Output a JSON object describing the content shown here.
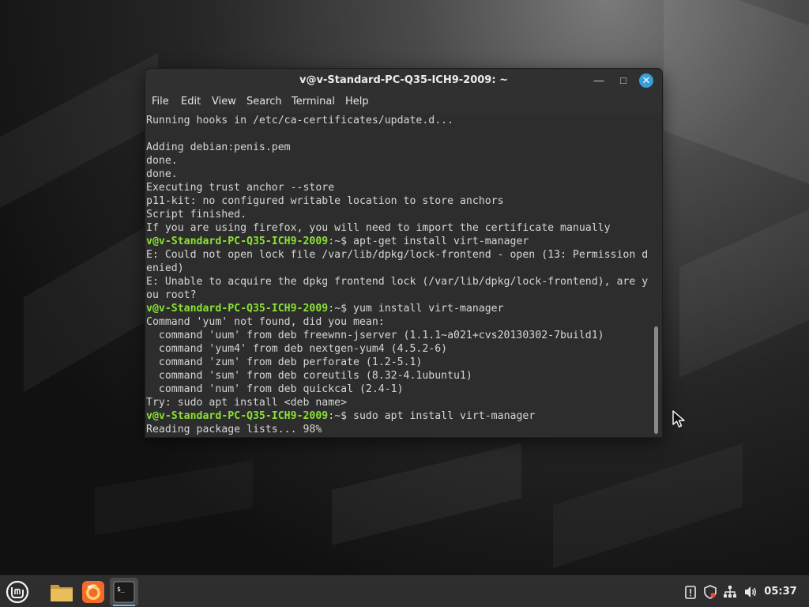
{
  "window": {
    "title": "v@v-Standard-PC-Q35-ICH9-2009: ~",
    "minimize_glyph": "—",
    "maximize_glyph": "□",
    "close_glyph": "✕"
  },
  "menu": [
    "File",
    "Edit",
    "View",
    "Search",
    "Terminal",
    "Help"
  ],
  "terminal": {
    "prompt_user": "v@v-Standard-PC-Q35-ICH9-2009",
    "prompt_suffix": ":~$ ",
    "lines": [
      {
        "type": "out",
        "text": "Running hooks in /etc/ca-certificates/update.d..."
      },
      {
        "type": "out",
        "text": ""
      },
      {
        "type": "out",
        "text": "Adding debian:penis.pem"
      },
      {
        "type": "out",
        "text": "done."
      },
      {
        "type": "out",
        "text": "done."
      },
      {
        "type": "out",
        "text": "Executing trust anchor --store"
      },
      {
        "type": "out",
        "text": "p11-kit: no configured writable location to store anchors"
      },
      {
        "type": "out",
        "text": "Script finished."
      },
      {
        "type": "out",
        "text": "If you are using firefox, you will need to import the certificate manually"
      },
      {
        "type": "cmd",
        "text": "apt-get install virt-manager"
      },
      {
        "type": "out",
        "text": "E: Could not open lock file /var/lib/dpkg/lock-frontend - open (13: Permission d"
      },
      {
        "type": "out",
        "text": "enied)"
      },
      {
        "type": "out",
        "text": "E: Unable to acquire the dpkg frontend lock (/var/lib/dpkg/lock-frontend), are y"
      },
      {
        "type": "out",
        "text": "ou root?"
      },
      {
        "type": "cmd",
        "text": "yum install virt-manager"
      },
      {
        "type": "out",
        "text": "Command 'yum' not found, did you mean:"
      },
      {
        "type": "out",
        "text": "  command 'uum' from deb freewnn-jserver (1.1.1~a021+cvs20130302-7build1)"
      },
      {
        "type": "out",
        "text": "  command 'yum4' from deb nextgen-yum4 (4.5.2-6)"
      },
      {
        "type": "out",
        "text": "  command 'zum' from deb perforate (1.2-5.1)"
      },
      {
        "type": "out",
        "text": "  command 'sum' from deb coreutils (8.32-4.1ubuntu1)"
      },
      {
        "type": "out",
        "text": "  command 'num' from deb quickcal (2.4-1)"
      },
      {
        "type": "out",
        "text": "Try: sudo apt install <deb name>"
      },
      {
        "type": "cmd",
        "text": "sudo apt install virt-manager"
      },
      {
        "type": "out",
        "text": "Reading package lists... 98%"
      }
    ]
  },
  "taskbar": {
    "menu_icon": "linux-mint-logo-icon",
    "launchers": [
      {
        "name": "files-icon"
      },
      {
        "name": "firefox-icon"
      },
      {
        "name": "terminal-icon",
        "glyph": "$_",
        "active": true
      }
    ],
    "tray": [
      {
        "name": "notifications-icon",
        "glyph": "!"
      },
      {
        "name": "shield-icon",
        "glyph": "⛨"
      },
      {
        "name": "network-icon",
        "glyph": "品"
      },
      {
        "name": "volume-icon",
        "glyph": "🔊"
      }
    ],
    "clock": "05:37"
  },
  "colors": {
    "prompt": "#8ae234",
    "terminal_bg": "#2d2d2d",
    "accent": "#35a0dc"
  }
}
